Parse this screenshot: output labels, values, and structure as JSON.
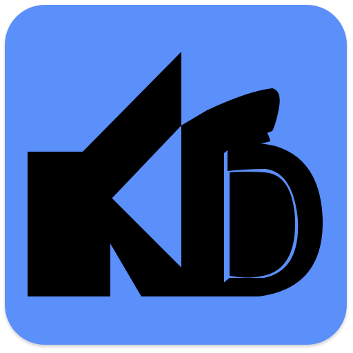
{
  "app_icon": {
    "name": "KB",
    "background_color": "#5b8ff9",
    "logo_color": "#000000",
    "icon": "kb-monogram-icon"
  }
}
